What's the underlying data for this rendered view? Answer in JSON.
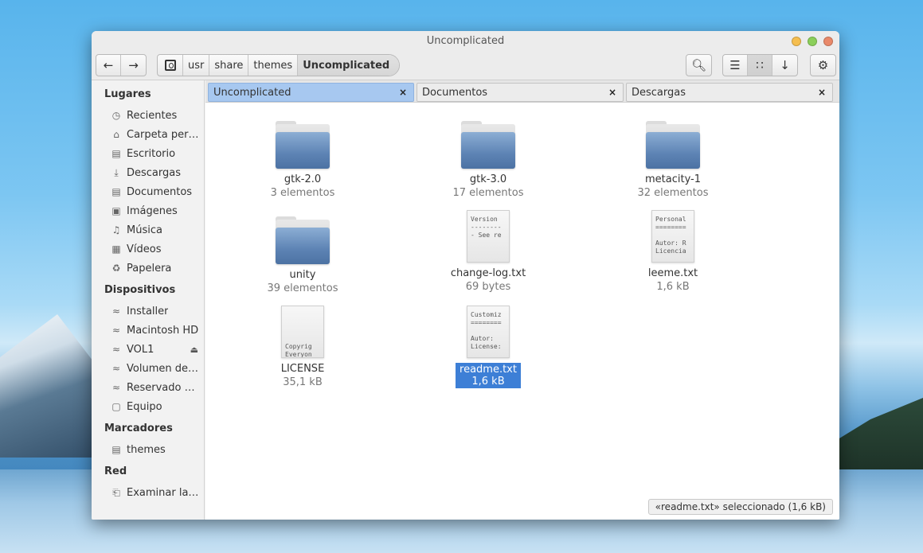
{
  "window": {
    "title": "Uncomplicated"
  },
  "toolbar": {
    "back_icon": "arrow-left-icon",
    "forward_icon": "arrow-right-icon",
    "breadcrumbs": [
      "usr",
      "share",
      "themes",
      "Uncomplicated"
    ],
    "search_icon": "search-icon",
    "list_view_icon": "list-view-icon",
    "grid_view_icon": "grid-view-icon",
    "sort_icon": "arrow-down-icon",
    "settings_icon": "gear-icon"
  },
  "sidebar": {
    "places_heading": "Lugares",
    "places": [
      {
        "label": "Recientes",
        "icon": "clock-icon"
      },
      {
        "label": "Carpeta pers…",
        "icon": "home-icon"
      },
      {
        "label": "Escritorio",
        "icon": "folder-icon"
      },
      {
        "label": "Descargas",
        "icon": "download-icon"
      },
      {
        "label": "Documentos",
        "icon": "folder-icon"
      },
      {
        "label": "Imágenes",
        "icon": "image-icon"
      },
      {
        "label": "Música",
        "icon": "music-icon"
      },
      {
        "label": "Vídeos",
        "icon": "video-icon"
      },
      {
        "label": "Papelera",
        "icon": "trash-icon"
      }
    ],
    "devices_heading": "Dispositivos",
    "devices": [
      {
        "label": "Installer",
        "icon": "network-icon"
      },
      {
        "label": "Macintosh HD",
        "icon": "network-icon"
      },
      {
        "label": "VOL1",
        "icon": "network-icon"
      },
      {
        "label": "Volumen de …",
        "icon": "network-icon"
      },
      {
        "label": "Reservado p…",
        "icon": "network-icon"
      },
      {
        "label": "Equipo",
        "icon": "computer-icon"
      }
    ],
    "bookmarks_heading": "Marcadores",
    "bookmarks": [
      {
        "label": "themes",
        "icon": "folder-icon"
      }
    ],
    "network_heading": "Red",
    "network": [
      {
        "label": "Examinar la r…",
        "icon": "network-browse-icon"
      }
    ]
  },
  "tabs": [
    {
      "label": "Uncomplicated",
      "close": "×"
    },
    {
      "label": "Documentos",
      "close": "×"
    },
    {
      "label": "Descargas",
      "close": "×"
    }
  ],
  "files": [
    {
      "name": "gtk-2.0",
      "meta": "3 elementos",
      "type": "folder"
    },
    {
      "name": "gtk-3.0",
      "meta": "17 elementos",
      "type": "folder"
    },
    {
      "name": "metacity-1",
      "meta": "32 elementos",
      "type": "folder"
    },
    {
      "name": "unity",
      "meta": "39 elementos",
      "type": "folder"
    },
    {
      "name": "change-log.txt",
      "meta": "69 bytes",
      "type": "text",
      "preview": "Version\n--------\n- See re"
    },
    {
      "name": "leeme.txt",
      "meta": "1,6 kB",
      "type": "text",
      "preview": "Personal\n========\n\nAutor: R\nLicencia"
    },
    {
      "name": "LICENSE",
      "meta": "35,1 kB",
      "type": "text",
      "preview": "\n\n\n\nCopyrig\nEveryon"
    },
    {
      "name": "readme.txt",
      "meta": "1,6 kB",
      "type": "text",
      "preview": "Customiz\n========\n\nAutor:\nLicense:",
      "selected": true
    }
  ],
  "status": {
    "text": "«readme.txt» seleccionado  (1,6 kB)"
  }
}
